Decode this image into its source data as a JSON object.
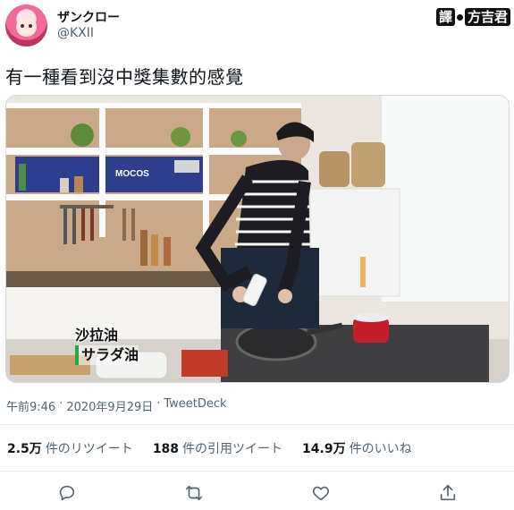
{
  "author": {
    "display_name": "ザンクロー",
    "handle": "@KXII"
  },
  "translator_badge": {
    "prefix": "譯",
    "name": "方吉君"
  },
  "tweet": {
    "text": "有一種看到沒中獎集數的感覺"
  },
  "media": {
    "caption_line1": "沙拉油",
    "caption_line2": "サラダ油",
    "store_sign": "MOCOS"
  },
  "meta": {
    "time": "午前9:46",
    "sep1": "·",
    "date": "2020年9月29日",
    "sep2": "·",
    "source": "TweetDeck"
  },
  "stats": {
    "retweets": {
      "count": "2.5万",
      "label": "件のリツイート"
    },
    "quotes": {
      "count": "188",
      "label": "件の引用ツイート"
    },
    "likes": {
      "count": "14.9万",
      "label": "件のいいね"
    }
  },
  "actions": {
    "icons": [
      "reply-icon",
      "retweet-icon",
      "like-icon",
      "share-icon"
    ]
  },
  "colors": {
    "text": "#0f1419",
    "secondary": "#536471",
    "icon": "#536471",
    "caption_accent": "#27a844"
  }
}
